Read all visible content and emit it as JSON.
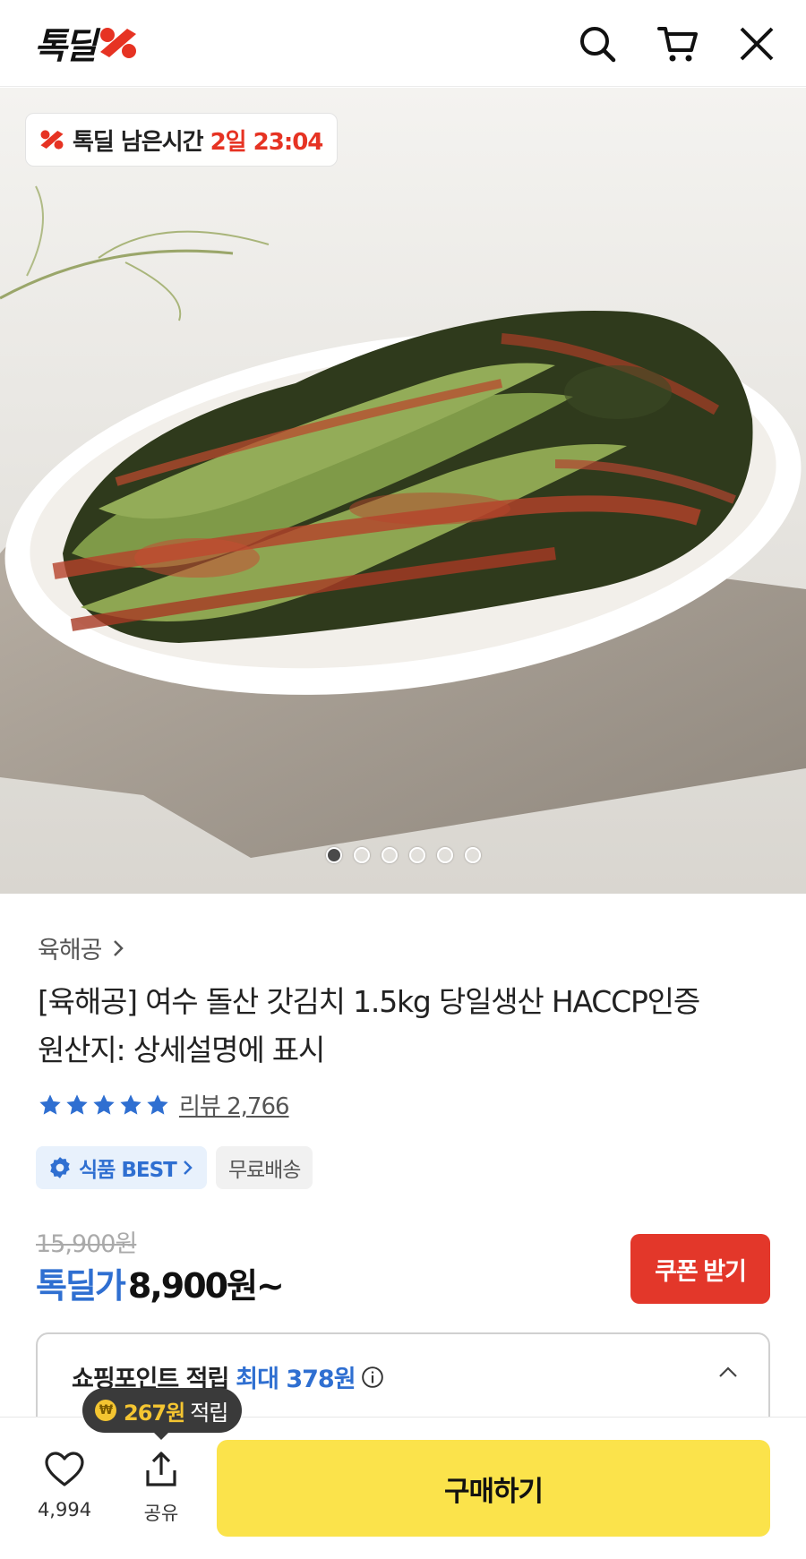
{
  "header": {
    "logo_text": "톡딜",
    "icons": [
      "search-icon",
      "cart-icon",
      "close-icon"
    ]
  },
  "hero": {
    "timer_label": "톡딜 남은시간",
    "timer_value": "2일 23:04",
    "image_count": 6,
    "active_index": 0
  },
  "product": {
    "brand": "육해공",
    "title_line1": "[육해공] 여수 돌산 갓김치 1.5kg 당일생산 HACCP인증",
    "title_line2": "원산지: 상세설명에 표시",
    "rating_stars": 5,
    "review_label": "리뷰 2,766",
    "badge_best": "식품 BEST",
    "badge_free": "무료배송"
  },
  "price": {
    "original": "15,900원",
    "label": "톡딜가",
    "value": "8,900원~",
    "coupon_button": "쿠폰 받기"
  },
  "points": {
    "title": "쇼핑포인트 적립",
    "max": "최대 378원"
  },
  "bottom": {
    "tooltip_amount": "267원",
    "tooltip_text": "적립",
    "like_count": "4,994",
    "share_label": "공유",
    "buy_label": "구매하기"
  },
  "colors": {
    "accent_red": "#e3372a",
    "accent_blue": "#2f6fd1",
    "buy_yellow": "#fbe34b"
  }
}
